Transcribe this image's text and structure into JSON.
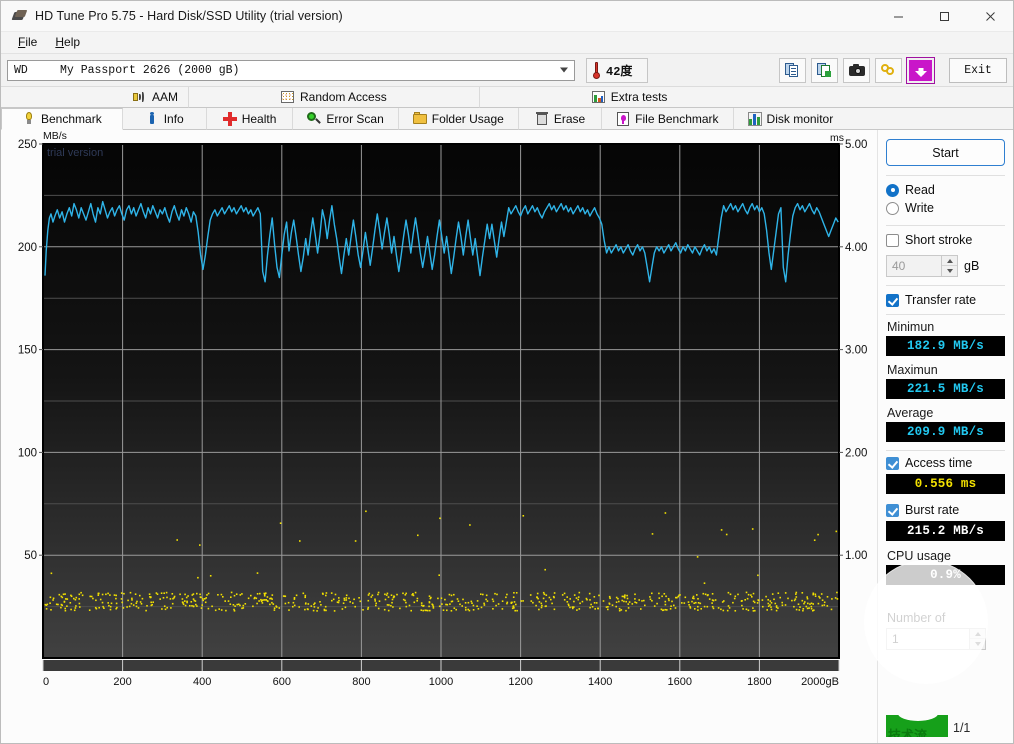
{
  "window": {
    "title": "HD Tune Pro 5.75 - Hard Disk/SSD Utility (trial version)",
    "icon": "harddisk-icon",
    "minimize": "–",
    "maximize": "☐",
    "close": "✕"
  },
  "menu": {
    "items": [
      {
        "label": "File",
        "mnemonic": "F"
      },
      {
        "label": "Help",
        "mnemonic": "H"
      }
    ]
  },
  "toolbar": {
    "drive": {
      "vendor": "WD",
      "model": "My Passport 2626 (2000 gB)",
      "dropdown_icon": "chevron-down-icon"
    },
    "temperature": {
      "icon": "thermometer-icon",
      "value": "42度"
    },
    "buttons": [
      {
        "name": "copy-text-button",
        "icon": "document-copy-icon",
        "label": ""
      },
      {
        "name": "copy-image-button",
        "icon": "image-copy-icon",
        "label": ""
      },
      {
        "name": "screenshot-button",
        "icon": "camera-icon",
        "label": ""
      },
      {
        "name": "link-button",
        "icon": "chain-link-icon",
        "label": ""
      },
      {
        "name": "download-button",
        "icon": "download-arrow-icon",
        "label": ""
      }
    ],
    "exit_label": "Exit"
  },
  "tabs": {
    "row1": [
      {
        "label": "AAM",
        "icon": "speaker-icon",
        "active": false
      },
      {
        "label": "Random Access",
        "icon": "random-dots-icon",
        "active": false
      },
      {
        "label": "Extra tests",
        "icon": "bar-chart-icon",
        "active": false
      }
    ],
    "row2": [
      {
        "label": "Benchmark",
        "icon": "lightbulb-icon",
        "active": true
      },
      {
        "label": "Info",
        "icon": "info-icon",
        "active": false
      },
      {
        "label": "Health",
        "icon": "red-cross-icon",
        "active": false
      },
      {
        "label": "Error Scan",
        "icon": "magnifier-icon",
        "active": false
      },
      {
        "label": "Folder Usage",
        "icon": "folder-icon",
        "active": false
      },
      {
        "label": "Erase",
        "icon": "trash-icon",
        "active": false
      },
      {
        "label": "File Benchmark",
        "icon": "file-flask-icon",
        "active": false
      },
      {
        "label": "Disk monitor",
        "icon": "monitor-bars-icon",
        "active": false
      }
    ]
  },
  "sidebar": {
    "start_label": "Start",
    "mode": {
      "read_label": "Read",
      "write_label": "Write",
      "selected": "Read"
    },
    "short_stroke": {
      "label": "Short stroke",
      "checked": false,
      "value": "40",
      "unit": "gB"
    },
    "transfer_rate": {
      "label": "Transfer rate",
      "checked": true,
      "minimum_label": "Minimun",
      "minimum_value": "182.9 MB/s",
      "maximum_label": "Maximun",
      "maximum_value": "221.5 MB/s",
      "average_label": "Average",
      "average_value": "209.9 MB/s"
    },
    "access_time": {
      "label": "Access time",
      "checked": true,
      "value": "0.556 ms"
    },
    "burst_rate": {
      "label": "Burst rate",
      "checked": true,
      "value": "215.2 MB/s"
    },
    "cpu_usage": {
      "label": "CPU usage",
      "value": "0.9%"
    },
    "number_of": {
      "label": "Number of",
      "value": "1"
    },
    "page_indicator": "1/1",
    "logo_text": "技术流"
  },
  "chart_data": {
    "type": "line",
    "title": "",
    "watermark": "trial version",
    "xlabel": "",
    "ylabel": "MB/s",
    "y2label": "ms",
    "xlim": [
      0,
      2000
    ],
    "ylim": [
      0,
      250
    ],
    "y2lim": [
      0,
      5
    ],
    "xticks": [
      "0",
      "200",
      "400",
      "600",
      "800",
      "1000",
      "1200",
      "1400",
      "1600",
      "1800",
      "2000gB"
    ],
    "xtick_values": [
      0,
      200,
      400,
      600,
      800,
      1000,
      1200,
      1400,
      1600,
      1800,
      2000
    ],
    "yticks": [
      "250",
      "200",
      "150",
      "100",
      "50"
    ],
    "ytick_values": [
      250,
      200,
      150,
      100,
      50
    ],
    "y2ticks": [
      "5.00",
      "4.00",
      "3.00",
      "2.00",
      "1.00"
    ],
    "y2tick_values": [
      5.0,
      4.0,
      3.0,
      2.0,
      1.0
    ],
    "grid": true,
    "grid_minor_step": 25,
    "plot_bg_top": "#050505",
    "plot_bg_bottom": "#414141",
    "series": [
      {
        "name": "Transfer rate",
        "color": "#2fb4e8",
        "unit": "MB/s",
        "axis": "left",
        "x": [
          5,
          8,
          12,
          16,
          20,
          25,
          30,
          36,
          42,
          48,
          54,
          60,
          66,
          72,
          78,
          84,
          90,
          96,
          102,
          108,
          114,
          120,
          126,
          132,
          138,
          144,
          150,
          156,
          162,
          168,
          174,
          180,
          186,
          192,
          198,
          204,
          210,
          216,
          222,
          228,
          234,
          240,
          246,
          252,
          258,
          264,
          270,
          276,
          282,
          288,
          294,
          300,
          306,
          312,
          318,
          324,
          330,
          336,
          342,
          348,
          354,
          360,
          366,
          372,
          378,
          384,
          390,
          396,
          402,
          408,
          414,
          420,
          426,
          432,
          438,
          444,
          450,
          456,
          462,
          468,
          474,
          480,
          486,
          492,
          498,
          504,
          510,
          516,
          522,
          528,
          534,
          540,
          546,
          552,
          558,
          564,
          570,
          576,
          582,
          588,
          594,
          600,
          606,
          612,
          618,
          624,
          630,
          636,
          642,
          648,
          654,
          660,
          666,
          672,
          678,
          684,
          690,
          696,
          702,
          708,
          714,
          720,
          726,
          732,
          738,
          744,
          750,
          756,
          762,
          768,
          774,
          780,
          786,
          792,
          798,
          804,
          810,
          816,
          822,
          828,
          834,
          840,
          846,
          852,
          858,
          864,
          870,
          876,
          882,
          888,
          894,
          900,
          906,
          912,
          918,
          924,
          930,
          936,
          942,
          948,
          954,
          960,
          966,
          972,
          978,
          984,
          990,
          996,
          1002,
          1008,
          1014,
          1020,
          1026,
          1032,
          1038,
          1044,
          1050,
          1056,
          1062,
          1068,
          1074,
          1080,
          1086,
          1092,
          1098,
          1104,
          1110,
          1116,
          1122,
          1128,
          1134,
          1140,
          1146,
          1152,
          1158,
          1164,
          1170,
          1176,
          1182,
          1188,
          1194,
          1200,
          1206,
          1212,
          1218,
          1224,
          1230,
          1236,
          1242,
          1248,
          1254,
          1260,
          1266,
          1272,
          1278,
          1284,
          1290,
          1296,
          1302,
          1308,
          1314,
          1320,
          1326,
          1332,
          1338,
          1344,
          1350,
          1356,
          1362,
          1368,
          1374,
          1380,
          1386,
          1392,
          1398,
          1404,
          1410,
          1416,
          1422,
          1428,
          1434,
          1440,
          1446,
          1452,
          1458,
          1464,
          1470,
          1476,
          1482,
          1488,
          1494,
          1500,
          1506,
          1512,
          1518,
          1524,
          1530,
          1536,
          1542,
          1548,
          1554,
          1560,
          1566,
          1572,
          1578,
          1584,
          1590,
          1596,
          1602,
          1608,
          1614,
          1620,
          1626,
          1632,
          1638,
          1644,
          1650,
          1656,
          1662,
          1668,
          1674,
          1680,
          1686,
          1692,
          1698,
          1704,
          1710,
          1716,
          1722,
          1728,
          1734,
          1740,
          1746,
          1752,
          1758,
          1764,
          1770,
          1776,
          1782,
          1788,
          1794,
          1800,
          1806,
          1812,
          1818,
          1824,
          1830,
          1836,
          1842,
          1848,
          1854,
          1860,
          1866,
          1872,
          1878,
          1884,
          1890,
          1896,
          1902,
          1908,
          1914,
          1920,
          1926,
          1932,
          1938,
          1944,
          1950,
          1956,
          1962,
          1968,
          1974,
          1980,
          1986,
          1992,
          1998
        ],
        "y": [
          186,
          198,
          208,
          214,
          216,
          212,
          215,
          218,
          214,
          217,
          212,
          216,
          219,
          215,
          221,
          218,
          214,
          219,
          216,
          213,
          217,
          221,
          216,
          212,
          219,
          216,
          222,
          218,
          214,
          217,
          219,
          215,
          218,
          220,
          216,
          213,
          218,
          220,
          216,
          219,
          215,
          218,
          221,
          217,
          214,
          219,
          216,
          220,
          217,
          214,
          218,
          216,
          219,
          215,
          212,
          217,
          220,
          216,
          213,
          218,
          215,
          219,
          216,
          212,
          217,
          215,
          207,
          196,
          189,
          196,
          205,
          213,
          216,
          218,
          215,
          217,
          219,
          216,
          218,
          220,
          217,
          219,
          216,
          218,
          220,
          217,
          219,
          216,
          218,
          215,
          217,
          219,
          216,
          188,
          183,
          196,
          206,
          214,
          201,
          190,
          185,
          196,
          206,
          212,
          198,
          207,
          213,
          205,
          196,
          188,
          195,
          204,
          196,
          206,
          214,
          206,
          197,
          206,
          218,
          213,
          204,
          213,
          220,
          211,
          204,
          195,
          187,
          196,
          204,
          196,
          205,
          213,
          205,
          196,
          190,
          198,
          207,
          199,
          191,
          199,
          208,
          216,
          208,
          199,
          207,
          214,
          206,
          197,
          205,
          196,
          188,
          196,
          205,
          213,
          206,
          197,
          206,
          214,
          206,
          197,
          190,
          197,
          205,
          197,
          189,
          196,
          205,
          213,
          205,
          197,
          205,
          196,
          187,
          195,
          204,
          212,
          205,
          196,
          205,
          213,
          204,
          196,
          204,
          195,
          186,
          195,
          203,
          211,
          204,
          211,
          203,
          195,
          204,
          212,
          205,
          212,
          219,
          216,
          218,
          220,
          217,
          215,
          218,
          220,
          216,
          218,
          220,
          217,
          219,
          216,
          214,
          217,
          219,
          221,
          218,
          220,
          217,
          219,
          221,
          218,
          220,
          217,
          219,
          216,
          218,
          220,
          217,
          219,
          216,
          218,
          215,
          217,
          219,
          216,
          214,
          211,
          203,
          197,
          200,
          197,
          199,
          201,
          198,
          200,
          197,
          199,
          201,
          198,
          196,
          199,
          201,
          198,
          200,
          197,
          190,
          183,
          190,
          197,
          200,
          198,
          200,
          197,
          199,
          201,
          198,
          200,
          202,
          199,
          197,
          200,
          198,
          201,
          199,
          197,
          200,
          198,
          196,
          199,
          201,
          198,
          200,
          197,
          199,
          196,
          205,
          214,
          220,
          217,
          219,
          221,
          218,
          220,
          217,
          219,
          221,
          218,
          216,
          219,
          221,
          218,
          220,
          217,
          219,
          216,
          208,
          197,
          189,
          198,
          207,
          216,
          219,
          190,
          183,
          196,
          206,
          215,
          219,
          221,
          218,
          220,
          217,
          219,
          221,
          218,
          216,
          219,
          217,
          214,
          211,
          208,
          205,
          208,
          211,
          214,
          212,
          209
        ],
        "minimum": 182.9,
        "maximum": 221.5,
        "average": 209.9
      },
      {
        "name": "Access time",
        "color": "#f2e000",
        "unit": "ms",
        "axis": "right",
        "style": "scatter",
        "cluster_center": 0.556,
        "cluster_spread": 0.09,
        "outlier_max": 1.35,
        "point_count": 740
      }
    ]
  }
}
